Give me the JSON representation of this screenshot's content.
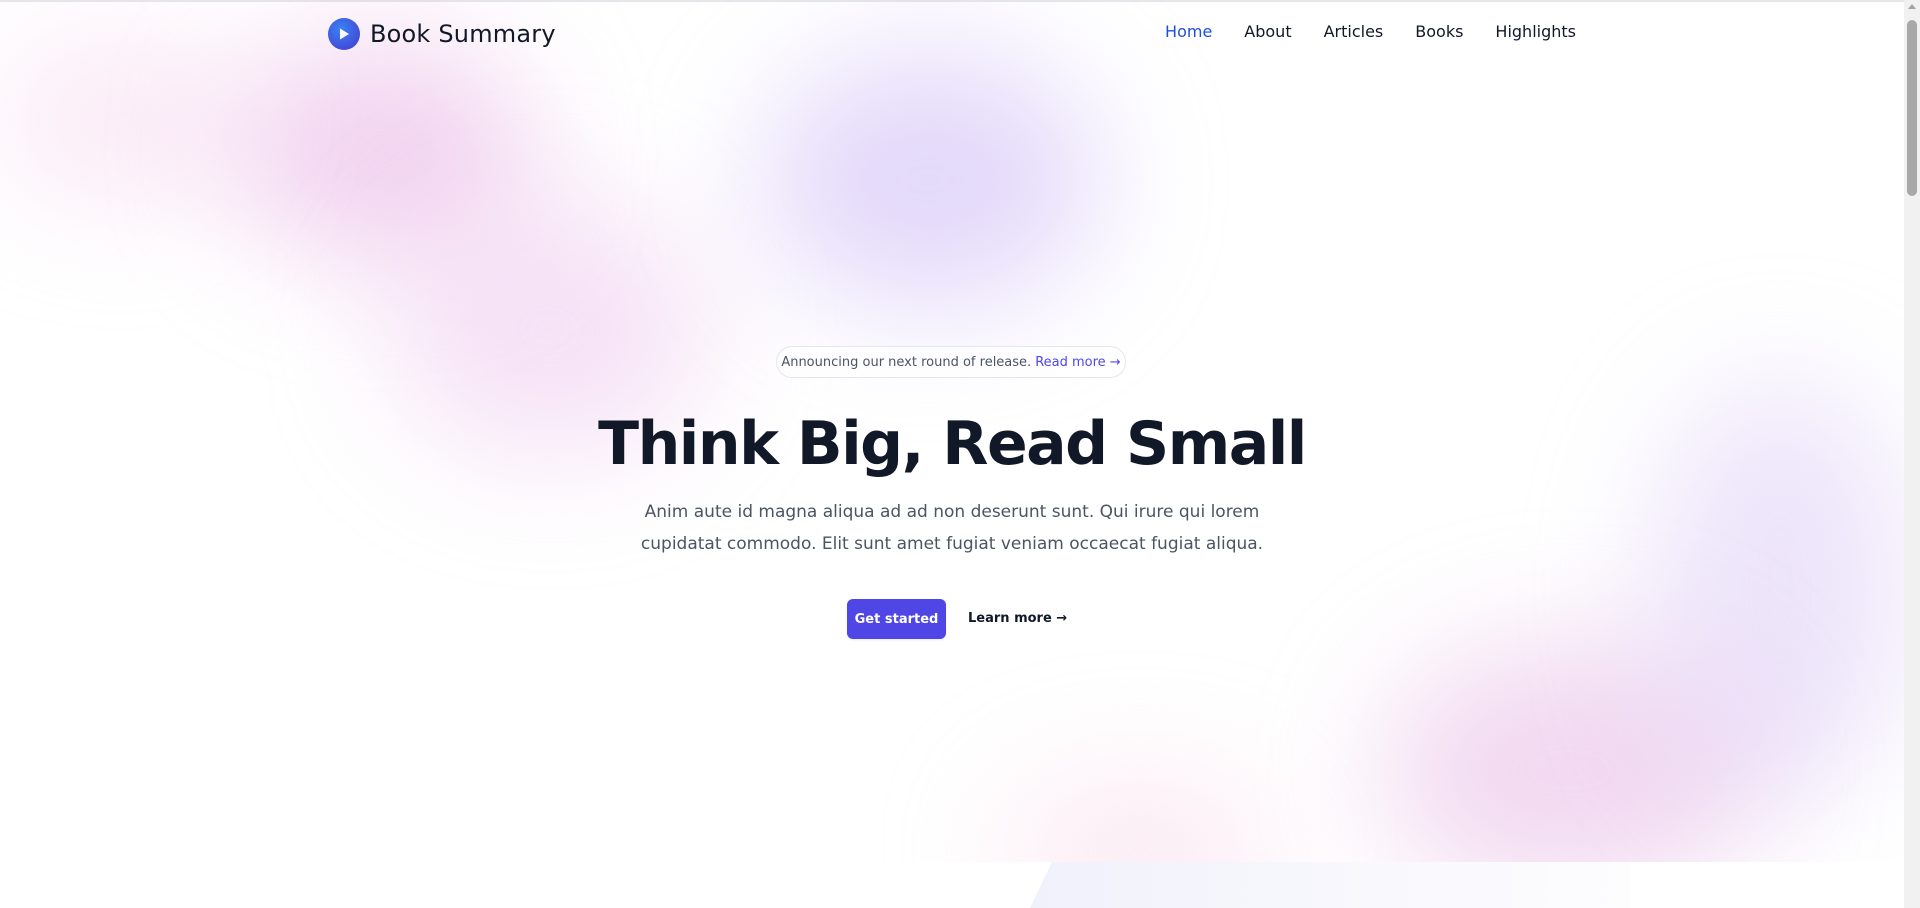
{
  "brand": {
    "name": "Book Summary",
    "logo_icon": "play-circle-icon",
    "colors": {
      "logo_start": "#3b82f6",
      "logo_end": "#4338ca"
    }
  },
  "nav": {
    "items": [
      {
        "label": "Home",
        "active": true
      },
      {
        "label": "About",
        "active": false
      },
      {
        "label": "Articles",
        "active": false
      },
      {
        "label": "Books",
        "active": false
      },
      {
        "label": "Highlights",
        "active": false
      }
    ],
    "active_color": "#1d4ed8"
  },
  "hero": {
    "announcement": "Announcing our next round of release.",
    "announcement_link": "Read more →",
    "title": "Think Big, Read Small",
    "subtitle": "Anim aute id magna aliqua ad ad non deserunt sunt. Qui irure qui lorem cupidatat commodo. Elit sunt amet fugiat veniam occaecat fugiat aliqua.",
    "primary_cta": "Get started",
    "secondary_cta": "Learn more →"
  },
  "theme": {
    "accent": "#4f46e5",
    "text": "#111827",
    "muted_text": "#4b5563"
  }
}
